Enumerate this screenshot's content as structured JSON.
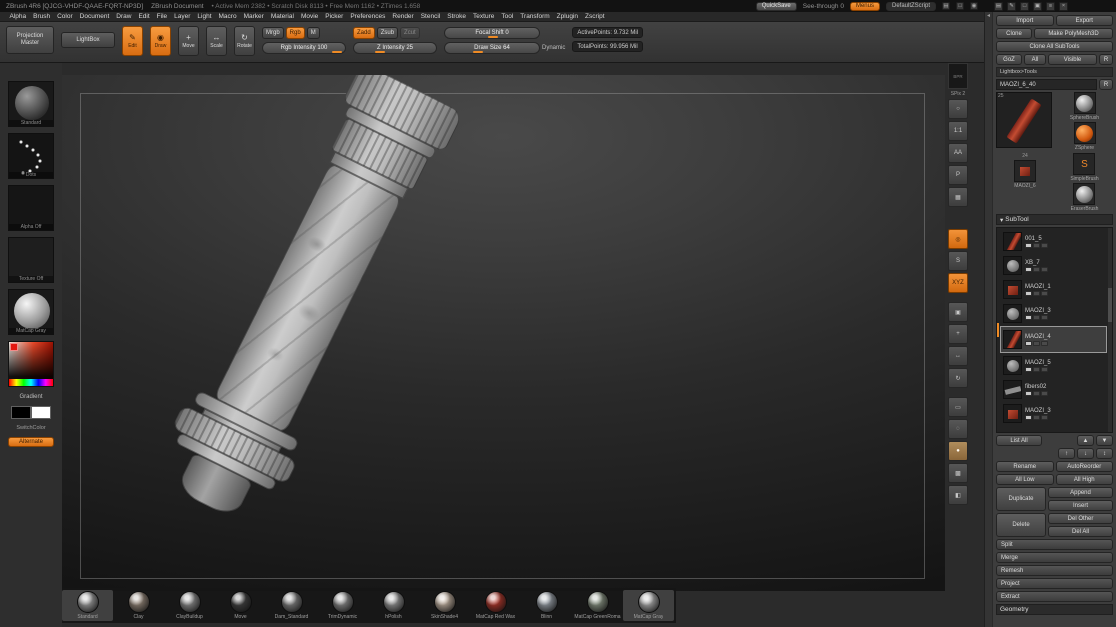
{
  "title_bar": {
    "app_title": "ZBrush 4R6 [QJCG-VHDF-QAAE-FQRT-NP3D]",
    "doc_title": "ZBrush Document",
    "stats": "• Active Mem 2382 • Scratch Disk 8113 • Free Mem 1162 • ZTimes 1.658",
    "quicksave_label": "QuickSave",
    "see_through_label": "See-through 0",
    "menus_label": "Menus",
    "zscript_label": "DefaultZScript",
    "icons": [
      {
        "name": "grid-icon",
        "glyph": "▤"
      },
      {
        "name": "doc-icon",
        "glyph": "□"
      },
      {
        "name": "info-icon",
        "glyph": "◉"
      }
    ]
  },
  "menu_bar": {
    "items": [
      "Alpha",
      "Brush",
      "Color",
      "Document",
      "Draw",
      "Edit",
      "File",
      "Layer",
      "Light",
      "Macro",
      "Marker",
      "Material",
      "Movie",
      "Picker",
      "Preferences",
      "Render",
      "Stencil",
      "Stroke",
      "Texture",
      "Tool",
      "Transform",
      "Zplugin",
      "Zscript"
    ]
  },
  "shelf": {
    "projection_master": "Projection Master",
    "lightbox": "LightBox",
    "modes": [
      {
        "name": "edit",
        "label": "Edit",
        "glyph": "✎"
      },
      {
        "name": "draw",
        "label": "Draw",
        "glyph": "◉"
      },
      {
        "name": "move",
        "label": "Move",
        "glyph": "+"
      },
      {
        "name": "scale",
        "label": "Scale",
        "glyph": "↔"
      },
      {
        "name": "rotate",
        "label": "Rotate",
        "glyph": "↻"
      }
    ],
    "mrgb": "Mrgb",
    "rgb": "Rgb",
    "m": "M",
    "rgb_intensity": "Rgb Intensity 100",
    "zadd": "Zadd",
    "zsub": "Zsub",
    "zcut": "Zcut",
    "z_intensity": "Z Intensity 25",
    "focal_shift": "Focal Shift 0",
    "draw_size": "Draw Size 64",
    "dynamic": "Dynamic",
    "active_points": "ActivePoints: 9.732 Mil",
    "total_points": "TotalPoints: 99.956 Mil"
  },
  "left_panel": {
    "brush_label": "Standard",
    "stroke_label": "Dots",
    "alpha_label": "Alpha Off",
    "texture_label": "Texture Off",
    "material_label": "MatCap Gray",
    "gradient_label": "Gradient",
    "switch_label": "SwitchColor",
    "alternate_label": "Alternate"
  },
  "right_shelf": {
    "bpr_label": "BPR",
    "spix_label": "SPix 2",
    "items": [
      {
        "name": "scroll-icon",
        "glyph": "○"
      },
      {
        "name": "actual-icon",
        "glyph": "1:1"
      },
      {
        "name": "aahalf-icon",
        "glyph": "AA"
      },
      {
        "name": "persp-icon",
        "glyph": "P"
      },
      {
        "name": "floor-icon",
        "glyph": "▦"
      },
      {
        "name": "local-icon",
        "glyph": "◎"
      },
      {
        "name": "lsym-icon",
        "glyph": "S"
      },
      {
        "name": "xyz-icon",
        "glyph": "XYZ"
      },
      {
        "name": "frame-icon",
        "glyph": "▣"
      },
      {
        "name": "move-icon",
        "glyph": "+"
      },
      {
        "name": "scale-icon",
        "glyph": "↔"
      },
      {
        "name": "rotate-icon",
        "glyph": "↻"
      },
      {
        "name": "transp-icon",
        "glyph": "▭"
      },
      {
        "name": "ghost-icon",
        "glyph": "◌"
      },
      {
        "name": "solo-icon",
        "glyph": "●"
      },
      {
        "name": "polyframe-icon",
        "glyph": "▩"
      },
      {
        "name": "silhouette-icon",
        "glyph": "◧"
      }
    ]
  },
  "panel_icons": [
    {
      "name": "layout-icon",
      "glyph": "▤"
    },
    {
      "name": "pen-icon",
      "glyph": "✎"
    },
    {
      "name": "doc-icon",
      "glyph": "□"
    },
    {
      "name": "palette-icon",
      "glyph": "▣"
    },
    {
      "name": "menu-icon",
      "glyph": "≡"
    },
    {
      "name": "close-icon",
      "glyph": "×"
    }
  ],
  "divider_arrow": "◂",
  "tool_panel": {
    "import": "Import",
    "export": "Export",
    "clone": "Clone",
    "make_polymesh": "Make PolyMesh3D",
    "clone_all": "Clone All SubTools",
    "goz": "GoZ",
    "all": "All",
    "visible": "Visible",
    "r": "R",
    "lightbox_tools": "Lightbox>Tools",
    "tool_name": "MAOZI_6_40",
    "tool_r": "R",
    "slot_25": "25",
    "slot_24": "24",
    "current_tool_label": "MAOZI_6",
    "quick_picks": [
      {
        "name": "sphere-brush",
        "label": "SphereBrush",
        "glyph": ""
      },
      {
        "name": "zsphere",
        "label": "ZSphere",
        "glyph": ""
      },
      {
        "name": "simple-brush",
        "label": "SimpleBrush",
        "glyph": "S"
      },
      {
        "name": "eraser-brush",
        "label": "EraserBrush",
        "glyph": ""
      }
    ]
  },
  "subtool": {
    "header": "SubTool",
    "collapse_glyph": "▾",
    "items": [
      {
        "name": "001_5"
      },
      {
        "name": "XB_7"
      },
      {
        "name": "MAOZI_1"
      },
      {
        "name": "MAOZI_3"
      },
      {
        "name": "MAOZI_4"
      },
      {
        "name": "MAOZI_5"
      },
      {
        "name": "fibers02"
      },
      {
        "name": "MAOZI_3"
      }
    ],
    "selected": "MAOZI_4",
    "icons": {
      "up": "▲",
      "down": "▼",
      "move_up": "↑",
      "move_down": "↓",
      "swap": "↕"
    },
    "buttons": {
      "list_all": "List All",
      "rename": "Rename",
      "autoreorder": "AutoReorder",
      "all_low": "All Low",
      "all_high": "All High",
      "duplicate": "Duplicate",
      "append": "Append",
      "insert": "Insert",
      "delete": "Delete",
      "del_other": "Del Other",
      "del_all": "Del All"
    },
    "sections": [
      "Split",
      "Merge",
      "Remesh",
      "Project",
      "Extract"
    ]
  },
  "geometry_header": "Geometry",
  "tray": {
    "items": [
      {
        "label": "Standard",
        "style": "--c:#b2b2b2"
      },
      {
        "label": "Clay",
        "style": "--c:#a39384"
      },
      {
        "label": "ClayBuildup",
        "style": "--c:#9c9c9c"
      },
      {
        "label": "Move",
        "style": "--c:#474747"
      },
      {
        "label": "Dam_Standard",
        "style": "--c:#8f8f8f"
      },
      {
        "label": "TrimDynamic",
        "style": "--c:#999999"
      },
      {
        "label": "hPolish",
        "style": "--c:#a6a6a6"
      },
      {
        "label": "SkinShade4",
        "style": "--c:#d8c5b2"
      },
      {
        "label": "MatCap Red Wax",
        "style": "--c:#c43a2c"
      },
      {
        "label": "Blinn",
        "style": "--c:#a9b1ba"
      },
      {
        "label": "MatCap GreenRoma",
        "style": "--c:#97a390"
      },
      {
        "label": "MatCap Gray",
        "style": "--c:#c2c2c2"
      }
    ]
  },
  "colors": {
    "accent_orange": "#ef8b25",
    "canvas_dark": "#141414",
    "panel_gray": "#3d3d3d"
  }
}
